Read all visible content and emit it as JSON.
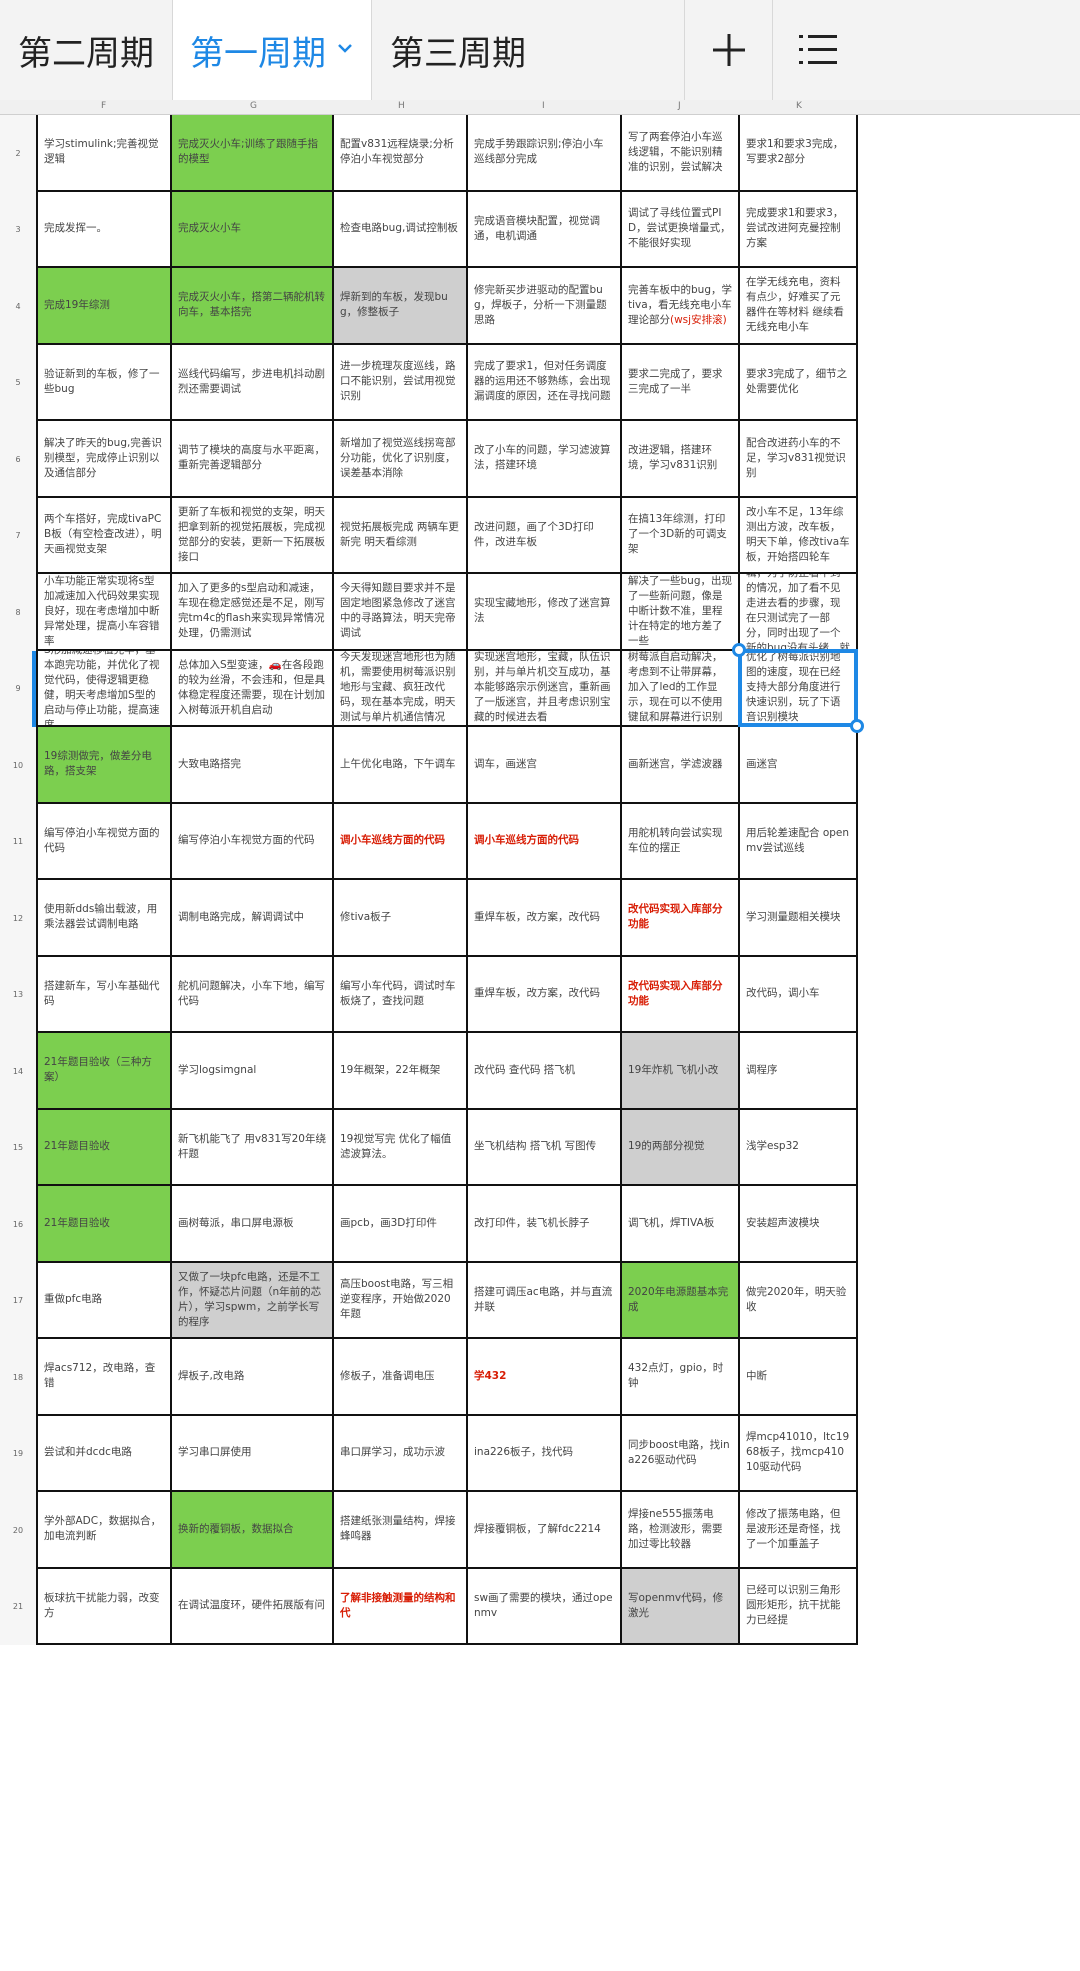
{
  "tabs": [
    {
      "label": "第二周期",
      "active": false
    },
    {
      "label": "第一周期",
      "active": true
    },
    {
      "label": "第三周期",
      "active": false
    }
  ],
  "toolbar": {
    "add_icon": "plus-icon",
    "menu_icon": "list-icon"
  },
  "columns": [
    "F",
    "G",
    "H",
    "I",
    "J",
    "K"
  ],
  "colors": {
    "accent": "#1e88e5",
    "green": "#7ccf4f",
    "gray": "#cfcfcf",
    "red": "#d81e06"
  },
  "rows": [
    {
      "num": "2",
      "cells": [
        {
          "text": "学习stimulink;完善视觉逻辑",
          "style": "plain"
        },
        {
          "text": "完成灭火小车;训练了跟随手指的模型",
          "style": "green"
        },
        {
          "text": "配置v831远程烧录;分析停泊小车视觉部分",
          "style": "plain"
        },
        {
          "text": "完成手势跟踪识别;停泊小车巡线部分完成",
          "style": "plain"
        },
        {
          "text": "写了两套停泊小车巡线逻辑，不能识别精准的识别，尝试解决",
          "style": "plain"
        },
        {
          "text": "要求1和要求3完成，写要求2部分",
          "style": "plain"
        }
      ]
    },
    {
      "num": "3",
      "cells": [
        {
          "text": "完成发挥一。",
          "style": "plain"
        },
        {
          "text": "完成灭火小车",
          "style": "green"
        },
        {
          "text": "检查电路bug,调试控制板",
          "style": "plain"
        },
        {
          "text": "完成语音模块配置，视觉调通，电机调通",
          "style": "plain"
        },
        {
          "text": "调试了寻线位置式PID，尝试更换增量式，不能很好实现",
          "style": "plain"
        },
        {
          "text": "完成要求1和要求3，尝试改进阿克曼控制方案",
          "style": "plain"
        }
      ]
    },
    {
      "num": "4",
      "cells": [
        {
          "text": "完成19年综测",
          "style": "green"
        },
        {
          "text": "完成灭火小车，搭第二辆舵机转向车，基本搭完",
          "style": "green"
        },
        {
          "text": "焊新到的车板，发现bug，修整板子",
          "style": "gray"
        },
        {
          "text": "修完新买步进驱动的配置bug，焊板子，分析一下测量题思路",
          "style": "plain"
        },
        {
          "text": "完善车板中的bug，学tiva，看无线充电小车理论部分",
          "style": "plain",
          "note": "(wsj安排滚)"
        },
        {
          "text": "在学无线充电，资料有点少，好难买了元器件在等材料 继续看无线充电小车",
          "style": "plain"
        }
      ]
    },
    {
      "num": "5",
      "cells": [
        {
          "text": "验证新到的车板，修了一些bug",
          "style": "plain"
        },
        {
          "text": "巡线代码编写，步进电机抖动剧烈还需要调试",
          "style": "plain"
        },
        {
          "text": "进一步梳理灰度巡线，路口不能识别，尝试用视觉识别",
          "style": "plain"
        },
        {
          "text": "完成了要求1，但对任务调度器的运用还不够熟练，会出现漏调度的原因，还在寻找问题",
          "style": "plain"
        },
        {
          "text": "要求二完成了，要求三完成了一半",
          "style": "plain"
        },
        {
          "text": "要求3完成了，细节之处需要优化",
          "style": "plain"
        }
      ]
    },
    {
      "num": "6",
      "cells": [
        {
          "text": "解决了昨天的bug,完善识别模型，完成停止识别以及通信部分",
          "style": "plain"
        },
        {
          "text": "调节了模块的高度与水平距离，重新完善逻辑部分",
          "style": "plain"
        },
        {
          "text": "新增加了视觉巡线拐弯部分功能，优化了识别度，误差基本消除",
          "style": "plain"
        },
        {
          "text": "改了小车的问题，学习滤波算法，搭建环境",
          "style": "plain"
        },
        {
          "text": "改进逻辑，搭建环境，学习v831识别",
          "style": "plain"
        },
        {
          "text": "配合改进药小车的不足，学习v831视觉识别",
          "style": "plain"
        }
      ]
    },
    {
      "num": "7",
      "cells": [
        {
          "text": "两个车搭好，完成tivaPCB板（有空检查改进），明天画视觉支架",
          "style": "plain"
        },
        {
          "text": "更新了车板和视觉的支架，明天把拿到新的视觉拓展板，完成视觉部分的安装，更新一下拓展板接口",
          "style": "plain"
        },
        {
          "text": "视觉拓展板完成 两辆车更新完 明天看综测",
          "style": "plain"
        },
        {
          "text": "改进问题，画了个3D打印件，改进车板",
          "style": "plain"
        },
        {
          "text": "在搞13年综测，打印了一个3D新的可调支架",
          "style": "plain"
        },
        {
          "text": "改小车不足，13年综测出方波，改车板，明天下单，修改tiva车板，开始搭四轮车",
          "style": "plain"
        }
      ]
    },
    {
      "num": "8",
      "cells": [
        {
          "text": "小车功能正常实现将s型加减速加入代码效果实现良好，现在考虑增加中断异常处理，提高小车容错率",
          "style": "plain"
        },
        {
          "text": "加入了更多的s型启动和减速，车现在稳定感觉还是不足，刚写完tm4c的flash来实现异常情况处理，仍需测试",
          "style": "plain"
        },
        {
          "text": "今天得知题目要求并不是固定地图紧急修改了迷宫中的寻路算法，明天完帝调试",
          "style": "plain"
        },
        {
          "text": "实现宝藏地形，修改了迷宫算法",
          "style": "plain"
        },
        {
          "text": "解决了一些bug，出现了一些新问题，像是中断计数不准，里程计在特定的地方差了一些",
          "style": "plain"
        },
        {
          "text": "更新了一下小车的逻辑，为了防止看不到的情况，加了看不见走进去看的步骤，现在只测试完了一部分，同时出现了一个新的bug没有头绪，就是在家实",
          "style": "plain"
        }
      ]
    },
    {
      "num": "9",
      "cells": [
        {
          "text": "S形加减速移植完毕，基本跑完功能，并优化了视觉代码，使得逻辑更稳健，明天考虑增加S型的启动与停止功能，提高速度",
          "style": "plain"
        },
        {
          "text": "总体加入S型变速，🚗在各段跑的较为丝滑，不会违和，但是具体稳定程度还需要，现在计划加入树莓派开机自启动",
          "style": "plain"
        },
        {
          "text": "今天发现迷宫地形也为随机，需要使用树莓派识别地形与宝藏、疯狂改代码，现在基本完成，明天测试与单片机通信情况",
          "style": "plain"
        },
        {
          "text": "实现迷宫地形，宝藏，队伍识别，并与单片机交互成功，基本能够路宗示例迷宫，重新画了一版迷宫，并且考虑识别宝藏的时候进去看",
          "style": "plain"
        },
        {
          "text": "树莓派自启动解决，考虑到不让带屏幕，加入了led的工作显示，现在可以不使用键鼠和屏幕进行识别",
          "style": "plain"
        },
        {
          "text": "优化了树莓派识别地图的速度，现在已经支持大部分角度进行快速识别，玩了下语音识别模块",
          "style": "plain"
        }
      ]
    },
    {
      "num": "10",
      "cells": [
        {
          "text": "19综测做完，做差分电路，搭支架",
          "style": "green"
        },
        {
          "text": "大致电路搭完",
          "style": "plain"
        },
        {
          "text": "上午优化电路，下午调车",
          "style": "plain"
        },
        {
          "text": "调车，画迷宫",
          "style": "plain"
        },
        {
          "text": "画新迷宫，学滤波器",
          "style": "plain"
        },
        {
          "text": "画迷宫",
          "style": "plain"
        }
      ]
    },
    {
      "num": "11",
      "cells": [
        {
          "text": "编写停泊小车视觉方面的代码",
          "style": "plain"
        },
        {
          "text": "编写停泊小车视觉方面的代码",
          "style": "plain"
        },
        {
          "text": "调小车巡线方面的代码",
          "style": "red"
        },
        {
          "text": "调小车巡线方面的代码",
          "style": "red"
        },
        {
          "text": "用舵机转向尝试实现车位的摆正",
          "style": "plain"
        },
        {
          "text": "用后轮差速配合 openmv尝试巡线",
          "style": "plain"
        }
      ]
    },
    {
      "num": "12",
      "cells": [
        {
          "text": "使用新dds输出载波，用乘法器尝试调制电路",
          "style": "plain"
        },
        {
          "text": "调制电路完成，解调调试中",
          "style": "plain"
        },
        {
          "text": "修tiva板子",
          "style": "plain"
        },
        {
          "text": "重焊车板，改方案，改代码",
          "style": "plain"
        },
        {
          "text": "改代码实现入库部分功能",
          "style": "red"
        },
        {
          "text": "学习测量题相关模块",
          "style": "plain"
        }
      ]
    },
    {
      "num": "13",
      "cells": [
        {
          "text": "搭建新车，写小车基础代码",
          "style": "plain"
        },
        {
          "text": "舵机问题解决，小车下地，编写代码",
          "style": "plain"
        },
        {
          "text": "编写小车代码，调试时车板烧了，查找问题",
          "style": "plain"
        },
        {
          "text": "重焊车板，改方案，改代码",
          "style": "plain"
        },
        {
          "text": "改代码实现入库部分功能",
          "style": "red"
        },
        {
          "text": "改代码，调小车",
          "style": "plain"
        }
      ]
    },
    {
      "num": "14",
      "cells": [
        {
          "text": "21年题目验收（三种方案）",
          "style": "green"
        },
        {
          "text": "学习logsimgnal",
          "style": "plain"
        },
        {
          "text": "19年概架，22年概架",
          "style": "plain"
        },
        {
          "text": "改代码 查代码 搭飞机",
          "style": "plain"
        },
        {
          "text": "19年炸机 飞机小改",
          "style": "gray"
        },
        {
          "text": "调程序",
          "style": "plain"
        }
      ]
    },
    {
      "num": "15",
      "cells": [
        {
          "text": "21年题目验收",
          "style": "green"
        },
        {
          "text": "新飞机能飞了 用v831写20年绕杆题",
          "style": "plain"
        },
        {
          "text": "19视觉写完 优化了幅值滤波算法。",
          "style": "plain"
        },
        {
          "text": "坐飞机结构 搭飞机 写图传",
          "style": "plain"
        },
        {
          "text": "19的两部分视觉",
          "style": "gray"
        },
        {
          "text": "浅学esp32",
          "style": "plain"
        }
      ]
    },
    {
      "num": "16",
      "cells": [
        {
          "text": "21年题目验收",
          "style": "green"
        },
        {
          "text": "画树莓派，串口屏电源板",
          "style": "plain"
        },
        {
          "text": "画pcb，画3D打印件",
          "style": "plain"
        },
        {
          "text": "改打印件，装飞机长脖子",
          "style": "plain"
        },
        {
          "text": "调飞机，焊TIVA板",
          "style": "plain"
        },
        {
          "text": "安装超声波模块",
          "style": "plain"
        }
      ]
    },
    {
      "num": "17",
      "cells": [
        {
          "text": "重做pfc电路",
          "style": "plain"
        },
        {
          "text": "又做了一块pfc电路，还是不工作，怀疑芯片问题（n年前的芯片），学习spwm，之前学长写的程序",
          "style": "gray"
        },
        {
          "text": "高压boost电路，写三相逆变程序，开始做2020年题",
          "style": "plain"
        },
        {
          "text": "搭建可调压ac电路，并与直流并联",
          "style": "plain"
        },
        {
          "text": "2020年电源题基本完成",
          "style": "green"
        },
        {
          "text": "做完2020年，明天验收",
          "style": "plain"
        }
      ]
    },
    {
      "num": "18",
      "cells": [
        {
          "text": "焊acs712，改电路，查错",
          "style": "plain"
        },
        {
          "text": "焊板子,改电路",
          "style": "plain"
        },
        {
          "text": "修板子，准备调电压",
          "style": "plain"
        },
        {
          "text": "学432",
          "style": "red"
        },
        {
          "text": "432点灯，gpio，时钟",
          "style": "plain"
        },
        {
          "text": "中断",
          "style": "plain"
        }
      ]
    },
    {
      "num": "19",
      "cells": [
        {
          "text": "尝试和并dcdc电路",
          "style": "plain"
        },
        {
          "text": "学习串口屏使用",
          "style": "plain"
        },
        {
          "text": "串口屏学习，成功示波",
          "style": "plain"
        },
        {
          "text": "ina226板子，找代码",
          "style": "plain"
        },
        {
          "text": "同步boost电路，找ina226驱动代码",
          "style": "plain"
        },
        {
          "text": "焊mcp41010，ltc1968板子，找mcp41010驱动代码",
          "style": "plain"
        }
      ]
    },
    {
      "num": "20",
      "cells": [
        {
          "text": "学外部ADC，数据拟合，加电流判断",
          "style": "plain"
        },
        {
          "text": "换新的覆铜板，数据拟合",
          "style": "green"
        },
        {
          "text": "搭建纸张测量结构，焊接蜂鸣器",
          "style": "plain"
        },
        {
          "text": "焊接覆铜板，了解fdc2214",
          "style": "plain"
        },
        {
          "text": "焊接ne555振荡电路，检测波形，需要加过零比较器",
          "style": "plain"
        },
        {
          "text": "修改了振荡电路，但是波形还是奇怪，找了一个加重盖子",
          "style": "plain"
        }
      ]
    },
    {
      "num": "21",
      "cells": [
        {
          "text": "板球抗干扰能力弱，改变方",
          "style": "plain"
        },
        {
          "text": "在调试温度环，硬件拓展版有问",
          "style": "plain"
        },
        {
          "text": "了解非接触测量的结构和代",
          "style": "red"
        },
        {
          "text": "sw画了需要的模块，通过openmv",
          "style": "plain"
        },
        {
          "text": "写openmv代码，修激光",
          "style": "gray"
        },
        {
          "text": "已经可以识别三角形圆形矩形，抗干扰能力已经提",
          "style": "plain"
        }
      ]
    }
  ]
}
